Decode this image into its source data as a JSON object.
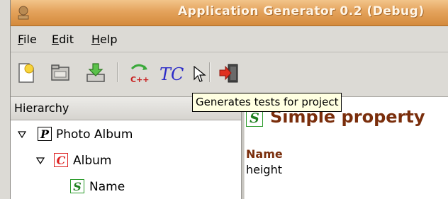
{
  "window": {
    "title": "Application Generator 0.2 (Debug)"
  },
  "menu": {
    "items": [
      {
        "mnemonic": "F",
        "rest": "ile"
      },
      {
        "mnemonic": "E",
        "rest": "dit"
      },
      {
        "mnemonic": "H",
        "rest": "elp"
      }
    ]
  },
  "toolbar": {
    "buttons": [
      {
        "icon": "new-project-icon"
      },
      {
        "icon": "open-project-icon"
      },
      {
        "icon": "save-project-icon"
      },
      {
        "icon": "generate-cpp-icon",
        "label": "C++"
      },
      {
        "icon": "generate-tests-icon",
        "label": "TC"
      },
      {
        "icon": "exit-icon"
      }
    ],
    "tooltip": "Generates tests for project"
  },
  "hierarchy": {
    "header": "Hierarchy",
    "rows": [
      {
        "badge": "P",
        "label": "Photo Album",
        "expanded": true
      },
      {
        "badge": "C",
        "label": "Album",
        "expanded": true
      },
      {
        "badge": "S",
        "label": "Name"
      }
    ]
  },
  "property_panel": {
    "badge": "S",
    "title": "Simple property",
    "field_label": "Name",
    "field_value": "height"
  },
  "colors": {
    "titlebar": "#e4a35c",
    "property_heading": "#7a2e0c",
    "class_badge": "#dd2222",
    "simple_badge": "#208020",
    "tooltip_bg": "#ffffe1"
  }
}
